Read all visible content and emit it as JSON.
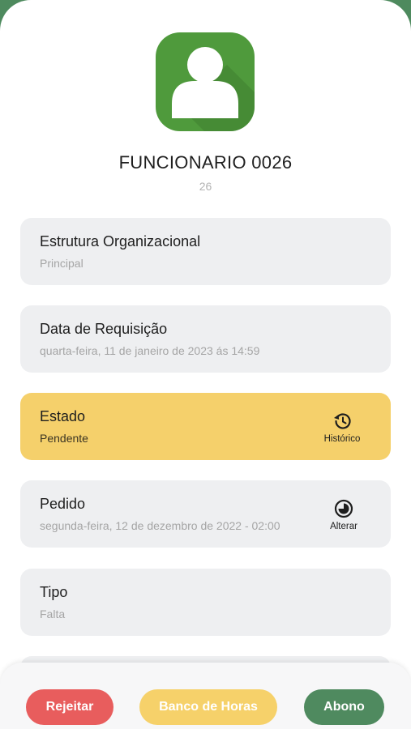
{
  "employee": {
    "name": "FUNCIONARIO 0026",
    "code": "26"
  },
  "cards": {
    "structure": {
      "title": "Estrutura Organizacional",
      "value": "Principal"
    },
    "request_date": {
      "title": "Data de Requisição",
      "value": "quarta-feira, 11 de janeiro de 2023 ás 14:59"
    },
    "state": {
      "title": "Estado",
      "value": "Pendente",
      "action_label": "Histórico",
      "action_icon": "history-icon"
    },
    "order": {
      "title": "Pedido",
      "value": "segunda-feira, 12 de dezembro de 2022 - 02:00",
      "action_label": "Alterar",
      "action_icon": "clock-icon"
    },
    "type": {
      "title": "Tipo",
      "value": "Falta"
    }
  },
  "actions": {
    "reject": "Rejeitar",
    "hour_bank": "Banco de Horas",
    "abono": "Abono"
  },
  "colors": {
    "background_green": "#4e8a5e",
    "avatar_green": "#4f9a3c",
    "state_yellow": "#f5d06b",
    "reject_red": "#e85d5d",
    "bank_yellow": "#f6d16a",
    "abono_green": "#4f8a5f"
  }
}
